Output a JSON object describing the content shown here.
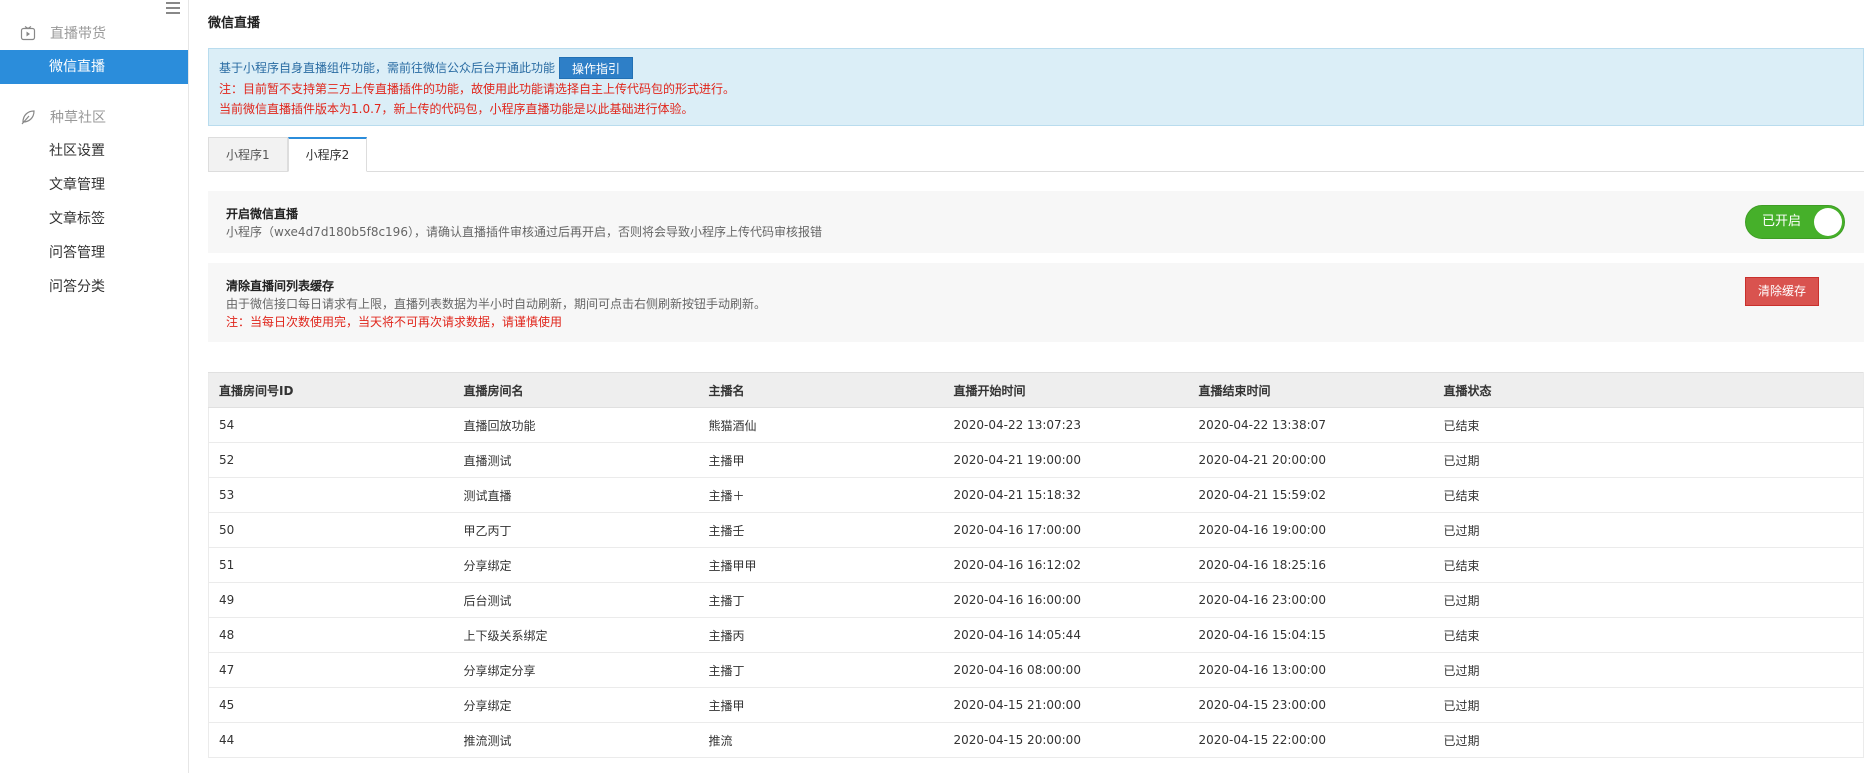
{
  "sidebar": {
    "groups": [
      {
        "label": "直播带货",
        "icon": "tv-icon",
        "items": [
          {
            "label": "微信直播",
            "active": true
          }
        ]
      },
      {
        "label": "种草社区",
        "icon": "leaf-icon",
        "items": [
          {
            "label": "社区设置"
          },
          {
            "label": "文章管理"
          },
          {
            "label": "文章标签"
          },
          {
            "label": "问答管理"
          },
          {
            "label": "问答分类"
          }
        ]
      }
    ]
  },
  "page": {
    "title": "微信直播"
  },
  "notice": {
    "line1": "基于小程序自身直播组件功能，需前往微信公众后台开通此功能",
    "guide_button": "操作指引",
    "line2": "注：目前暂不支持第三方上传直播插件的功能，故使用此功能请选择自主上传代码包的形式进行。",
    "line3": "当前微信直播插件版本为1.0.7，新上传的代码包，小程序直播功能是以此基础进行体验。"
  },
  "tabs": [
    {
      "label": "小程序1",
      "active": false
    },
    {
      "label": "小程序2",
      "active": true
    }
  ],
  "live_switch": {
    "title": "开启微信直播",
    "desc": "小程序（wxe4d7d180b5f8c196），请确认直播插件审核通过后再开启，否则将会导致小程序上传代码审核报错",
    "toggle_label": "已开启",
    "toggle_on": true,
    "toggle_color": "#46b02a"
  },
  "cache": {
    "title": "清除直播间列表缓存",
    "desc": "由于微信接口每日请求有上限，直播列表数据为半小时自动刷新，期间可点击右侧刷新按钮手动刷新。",
    "warn": "注：当每日次数使用完，当天将不可再次请求数据，请谨慎使用",
    "button": "清除缓存"
  },
  "table": {
    "columns": [
      "直播房间号ID",
      "直播房间名",
      "主播名",
      "直播开始时间",
      "直播结束时间",
      "直播状态"
    ],
    "rows": [
      [
        "54",
        "直播回放功能",
        "熊猫酒仙",
        "2020-04-22 13:07:23",
        "2020-04-22 13:38:07",
        "已结束"
      ],
      [
        "52",
        "直播测试",
        "主播甲",
        "2020-04-21 19:00:00",
        "2020-04-21 20:00:00",
        "已过期"
      ],
      [
        "53",
        "测试直播",
        "主播＋",
        "2020-04-21 15:18:32",
        "2020-04-21 15:59:02",
        "已结束"
      ],
      [
        "50",
        "甲乙丙丁",
        "主播壬",
        "2020-04-16 17:00:00",
        "2020-04-16 19:00:00",
        "已过期"
      ],
      [
        "51",
        "分享绑定",
        "主播甲甲",
        "2020-04-16 16:12:02",
        "2020-04-16 18:25:16",
        "已结束"
      ],
      [
        "49",
        "后台测试",
        "主播丁",
        "2020-04-16 16:00:00",
        "2020-04-16 23:00:00",
        "已过期"
      ],
      [
        "48",
        "上下级关系绑定",
        "主播丙",
        "2020-04-16 14:05:44",
        "2020-04-16 15:04:15",
        "已结束"
      ],
      [
        "47",
        "分享绑定分享",
        "主播丁",
        "2020-04-16 08:00:00",
        "2020-04-16 13:00:00",
        "已过期"
      ],
      [
        "45",
        "分享绑定",
        "主播甲",
        "2020-04-15 21:00:00",
        "2020-04-15 23:00:00",
        "已过期"
      ],
      [
        "44",
        "推流测试",
        "推流",
        "2020-04-15 20:00:00",
        "2020-04-15 22:00:00",
        "已过期"
      ]
    ]
  }
}
